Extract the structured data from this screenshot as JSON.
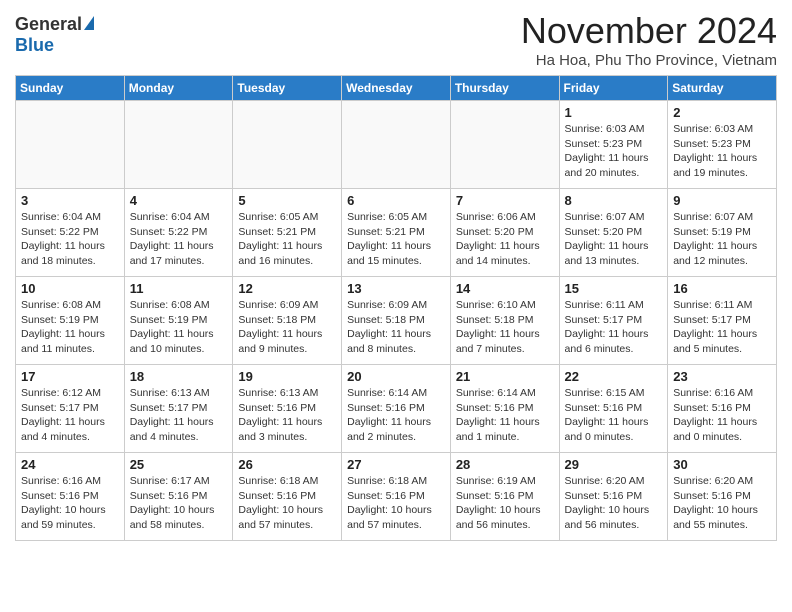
{
  "logo": {
    "general": "General",
    "blue": "Blue",
    "triangle": "▶"
  },
  "title": "November 2024",
  "subtitle": "Ha Hoa, Phu Tho Province, Vietnam",
  "headers": [
    "Sunday",
    "Monday",
    "Tuesday",
    "Wednesday",
    "Thursday",
    "Friday",
    "Saturday"
  ],
  "weeks": [
    [
      {
        "day": "",
        "info": "",
        "empty": true
      },
      {
        "day": "",
        "info": "",
        "empty": true
      },
      {
        "day": "",
        "info": "",
        "empty": true
      },
      {
        "day": "",
        "info": "",
        "empty": true
      },
      {
        "day": "",
        "info": "",
        "empty": true
      },
      {
        "day": "1",
        "info": "Sunrise: 6:03 AM\nSunset: 5:23 PM\nDaylight: 11 hours and 20 minutes."
      },
      {
        "day": "2",
        "info": "Sunrise: 6:03 AM\nSunset: 5:23 PM\nDaylight: 11 hours and 19 minutes."
      }
    ],
    [
      {
        "day": "3",
        "info": "Sunrise: 6:04 AM\nSunset: 5:22 PM\nDaylight: 11 hours and 18 minutes."
      },
      {
        "day": "4",
        "info": "Sunrise: 6:04 AM\nSunset: 5:22 PM\nDaylight: 11 hours and 17 minutes."
      },
      {
        "day": "5",
        "info": "Sunrise: 6:05 AM\nSunset: 5:21 PM\nDaylight: 11 hours and 16 minutes."
      },
      {
        "day": "6",
        "info": "Sunrise: 6:05 AM\nSunset: 5:21 PM\nDaylight: 11 hours and 15 minutes."
      },
      {
        "day": "7",
        "info": "Sunrise: 6:06 AM\nSunset: 5:20 PM\nDaylight: 11 hours and 14 minutes."
      },
      {
        "day": "8",
        "info": "Sunrise: 6:07 AM\nSunset: 5:20 PM\nDaylight: 11 hours and 13 minutes."
      },
      {
        "day": "9",
        "info": "Sunrise: 6:07 AM\nSunset: 5:19 PM\nDaylight: 11 hours and 12 minutes."
      }
    ],
    [
      {
        "day": "10",
        "info": "Sunrise: 6:08 AM\nSunset: 5:19 PM\nDaylight: 11 hours and 11 minutes."
      },
      {
        "day": "11",
        "info": "Sunrise: 6:08 AM\nSunset: 5:19 PM\nDaylight: 11 hours and 10 minutes."
      },
      {
        "day": "12",
        "info": "Sunrise: 6:09 AM\nSunset: 5:18 PM\nDaylight: 11 hours and 9 minutes."
      },
      {
        "day": "13",
        "info": "Sunrise: 6:09 AM\nSunset: 5:18 PM\nDaylight: 11 hours and 8 minutes."
      },
      {
        "day": "14",
        "info": "Sunrise: 6:10 AM\nSunset: 5:18 PM\nDaylight: 11 hours and 7 minutes."
      },
      {
        "day": "15",
        "info": "Sunrise: 6:11 AM\nSunset: 5:17 PM\nDaylight: 11 hours and 6 minutes."
      },
      {
        "day": "16",
        "info": "Sunrise: 6:11 AM\nSunset: 5:17 PM\nDaylight: 11 hours and 5 minutes."
      }
    ],
    [
      {
        "day": "17",
        "info": "Sunrise: 6:12 AM\nSunset: 5:17 PM\nDaylight: 11 hours and 4 minutes."
      },
      {
        "day": "18",
        "info": "Sunrise: 6:13 AM\nSunset: 5:17 PM\nDaylight: 11 hours and 4 minutes."
      },
      {
        "day": "19",
        "info": "Sunrise: 6:13 AM\nSunset: 5:16 PM\nDaylight: 11 hours and 3 minutes."
      },
      {
        "day": "20",
        "info": "Sunrise: 6:14 AM\nSunset: 5:16 PM\nDaylight: 11 hours and 2 minutes."
      },
      {
        "day": "21",
        "info": "Sunrise: 6:14 AM\nSunset: 5:16 PM\nDaylight: 11 hours and 1 minute."
      },
      {
        "day": "22",
        "info": "Sunrise: 6:15 AM\nSunset: 5:16 PM\nDaylight: 11 hours and 0 minutes."
      },
      {
        "day": "23",
        "info": "Sunrise: 6:16 AM\nSunset: 5:16 PM\nDaylight: 11 hours and 0 minutes."
      }
    ],
    [
      {
        "day": "24",
        "info": "Sunrise: 6:16 AM\nSunset: 5:16 PM\nDaylight: 10 hours and 59 minutes."
      },
      {
        "day": "25",
        "info": "Sunrise: 6:17 AM\nSunset: 5:16 PM\nDaylight: 10 hours and 58 minutes."
      },
      {
        "day": "26",
        "info": "Sunrise: 6:18 AM\nSunset: 5:16 PM\nDaylight: 10 hours and 57 minutes."
      },
      {
        "day": "27",
        "info": "Sunrise: 6:18 AM\nSunset: 5:16 PM\nDaylight: 10 hours and 57 minutes."
      },
      {
        "day": "28",
        "info": "Sunrise: 6:19 AM\nSunset: 5:16 PM\nDaylight: 10 hours and 56 minutes."
      },
      {
        "day": "29",
        "info": "Sunrise: 6:20 AM\nSunset: 5:16 PM\nDaylight: 10 hours and 56 minutes."
      },
      {
        "day": "30",
        "info": "Sunrise: 6:20 AM\nSunset: 5:16 PM\nDaylight: 10 hours and 55 minutes."
      }
    ]
  ]
}
